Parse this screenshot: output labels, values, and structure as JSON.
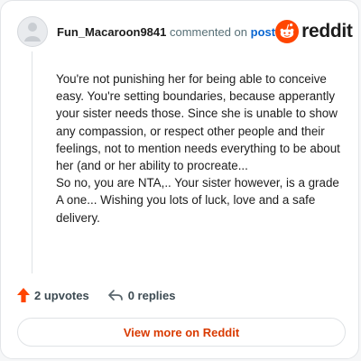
{
  "header": {
    "username": "Fun_Macaroon9841",
    "action": "commented on",
    "post_link": "post",
    "brand": "reddit"
  },
  "comment": {
    "body": "You're not punishing her for being able to conceive easy. You're setting boundaries, because apperantly your sister needs those. Since she is unable to show any compassion, or respect other people and their feelings, not to mention needs everything to be about her (and or her ability to procreate...\nSo no, you are NTA,.. Your sister however, is a grade A one... Wishing you lots of luck, love and a safe delivery."
  },
  "footer": {
    "upvotes": "2 upvotes",
    "replies": "0 replies"
  },
  "cta": {
    "label": "View more on Reddit"
  },
  "colors": {
    "accent": "#ff4500",
    "link": "#0a66d1",
    "cta_text": "#d93a00"
  },
  "icons": [
    "avatar",
    "reddit-logo-icon",
    "upvote-arrow-icon",
    "reply-arrow-icon"
  ]
}
